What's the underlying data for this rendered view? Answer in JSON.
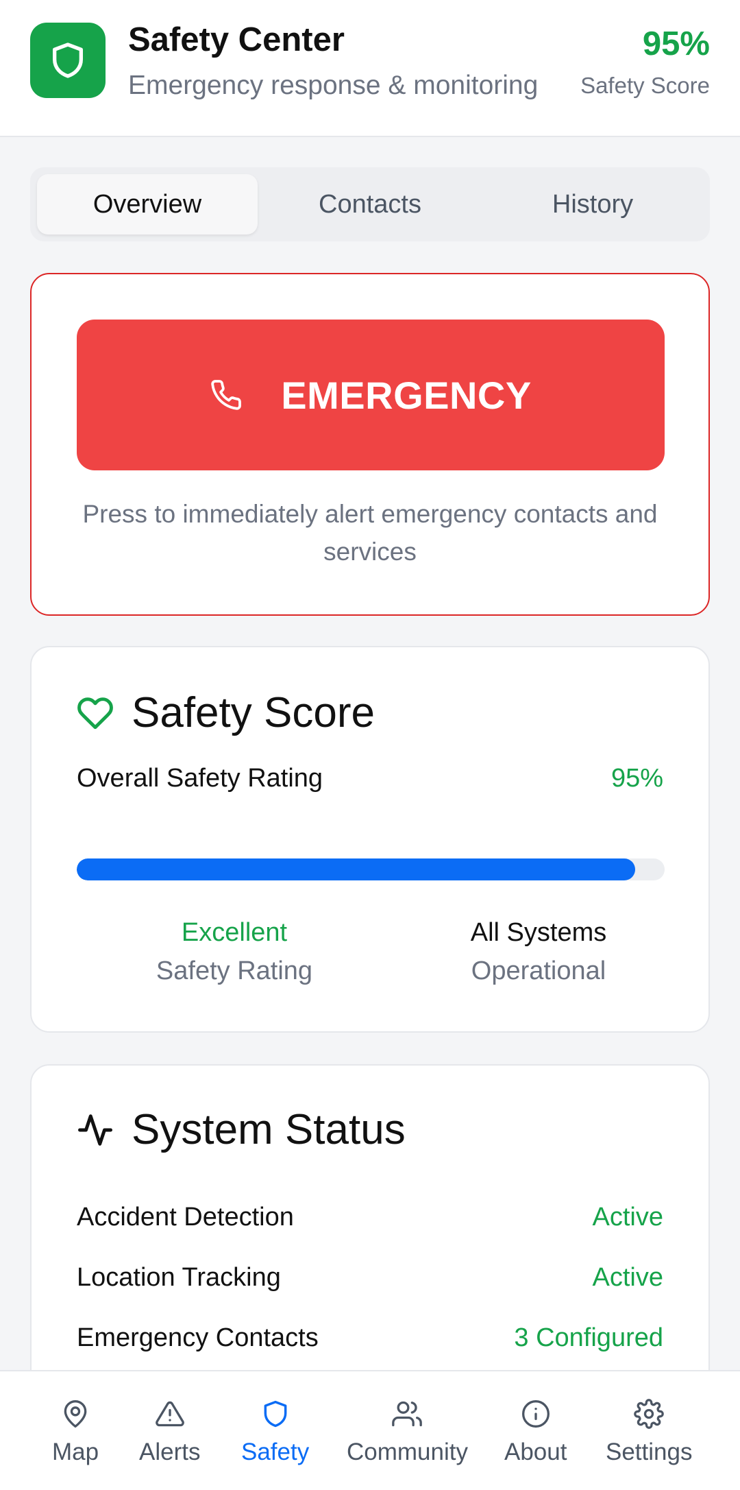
{
  "header": {
    "title": "Safety Center",
    "subtitle": "Emergency response & monitoring",
    "score_value": "95%",
    "score_label": "Safety Score"
  },
  "tabs": [
    {
      "label": "Overview",
      "active": true
    },
    {
      "label": "Contacts",
      "active": false
    },
    {
      "label": "History",
      "active": false
    }
  ],
  "emergency": {
    "button_label": "EMERGENCY",
    "icon": "phone-icon",
    "description": "Press to immediately alert emergency contacts and services"
  },
  "safety_score": {
    "title": "Safety Score",
    "icon": "heart-icon",
    "rating_label": "Overall Safety Rating",
    "rating_value": "95%",
    "progress_percent": 95,
    "stats": [
      {
        "top": "Excellent",
        "bottom": "Safety Rating"
      },
      {
        "top": "All Systems",
        "bottom": "Operational"
      }
    ]
  },
  "system_status": {
    "title": "System Status",
    "icon": "activity-icon",
    "rows": [
      {
        "label": "Accident Detection",
        "value": "Active"
      },
      {
        "label": "Location Tracking",
        "value": "Active"
      },
      {
        "label": "Emergency Contacts",
        "value": "3 Configured"
      }
    ]
  },
  "bottom_nav": [
    {
      "label": "Map",
      "icon": "map-pin-icon",
      "active": false
    },
    {
      "label": "Alerts",
      "icon": "alert-triangle-icon",
      "active": false
    },
    {
      "label": "Safety",
      "icon": "shield-icon",
      "active": true
    },
    {
      "label": "Community",
      "icon": "users-icon",
      "active": false
    },
    {
      "label": "About",
      "icon": "info-icon",
      "active": false
    },
    {
      "label": "Settings",
      "icon": "gear-icon",
      "active": false
    }
  ],
  "colors": {
    "accent_green": "#16a34a",
    "emergency_red": "#ef4444",
    "progress_blue": "#0b6cf5",
    "active_nav_blue": "#0b6cf5"
  }
}
